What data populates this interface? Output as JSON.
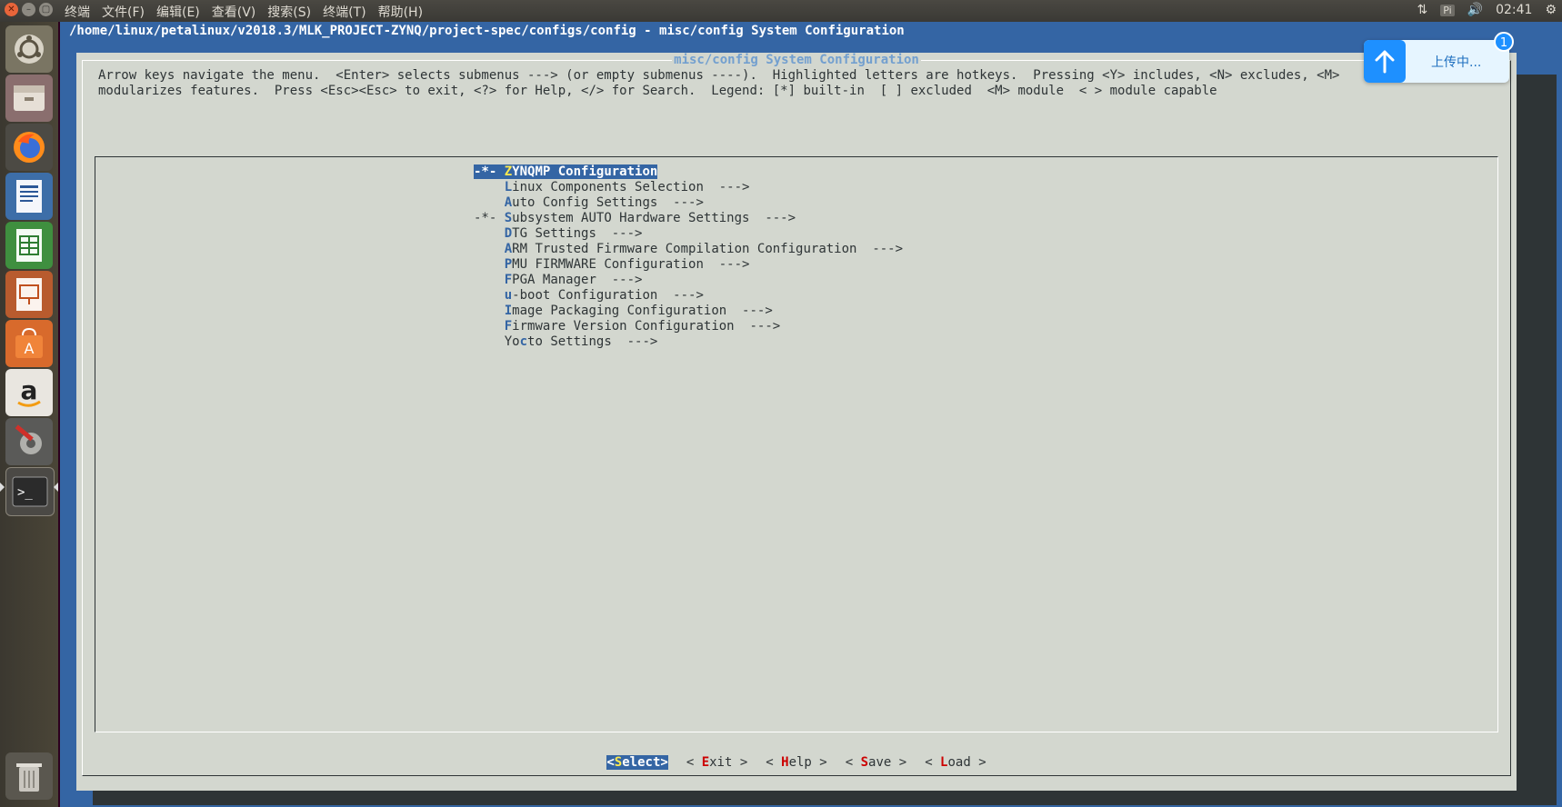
{
  "topbar": {
    "menus": [
      "终端",
      "文件(F)",
      "编辑(E)",
      "查看(V)",
      "搜索(S)",
      "终端(T)",
      "帮助(H)"
    ],
    "tray": {
      "keyboard": "Pi",
      "time": "02:41"
    }
  },
  "launcher": {
    "items": [
      "dash-icon",
      "files-icon",
      "firefox-icon",
      "writer-icon",
      "calc-icon",
      "impress-icon",
      "software-center-icon",
      "amazon-icon",
      "system-settings-icon",
      "terminal-icon",
      "trash-icon"
    ]
  },
  "terminal": {
    "path": "/home/linux/petalinux/v2018.3/MLK_PROJECT-ZYNQ/project-spec/configs/config - misc/config System Configuration",
    "dialog": {
      "title": "misc/config System Configuration",
      "help_line1": "Arrow keys navigate the menu.  <Enter> selects submenus ---> (or empty submenus ----).  Highlighted letters are hotkeys.  Pressing <Y> includes, <N> excludes, <M>",
      "help_line2": "modularizes features.  Press <Esc><Esc> to exit, <?> for Help, </> for Search.  Legend: [*] built-in  [ ] excluded  <M> module  < > module capable",
      "menu": [
        {
          "mark": "-*-",
          "hot": "Z",
          "rest": "YNQMP Configuration",
          "arrow": ""
        },
        {
          "mark": "   ",
          "hot": "L",
          "rest": "inux Components Selection",
          "arrow": "  --->"
        },
        {
          "mark": "   ",
          "hot": "A",
          "rest": "uto Config Settings",
          "arrow": "  --->"
        },
        {
          "mark": "-*-",
          "hot": "S",
          "rest": "ubsystem AUTO Hardware Settings",
          "arrow": "  --->"
        },
        {
          "mark": "   ",
          "hot": "D",
          "rest": "TG Settings",
          "arrow": "  --->"
        },
        {
          "mark": "   ",
          "hot": "A",
          "rest": "RM Trusted Firmware Compilation Configuration",
          "arrow": "  --->"
        },
        {
          "mark": "   ",
          "hot": "P",
          "rest": "MU FIRMWARE Configuration",
          "arrow": "  --->"
        },
        {
          "mark": "   ",
          "hot": "F",
          "rest": "PGA Manager",
          "arrow": "  --->"
        },
        {
          "mark": "   ",
          "hot": "u",
          "rest": "-boot Configuration",
          "arrow": "  --->"
        },
        {
          "mark": "   ",
          "hot": "I",
          "rest": "mage Packaging Configuration",
          "arrow": "  --->"
        },
        {
          "mark": "   ",
          "hot": "F",
          "rest": "irmware Version Configuration",
          "arrow": "  --->"
        },
        {
          "mark": "   ",
          "hot": "Y",
          "rest": "o",
          "hot2": "c",
          "rest2": "to Settings",
          "arrow": "  --->"
        }
      ],
      "buttons": [
        {
          "pre": "<",
          "hot": "S",
          "rest": "elect",
          "post": ">"
        },
        {
          "pre": "< ",
          "hot": "E",
          "rest": "xit",
          "post": " >"
        },
        {
          "pre": "< ",
          "hot": "H",
          "rest": "elp",
          "post": " >"
        },
        {
          "pre": "< ",
          "hot": "S",
          "rest": "ave",
          "post": " >"
        },
        {
          "pre": "< ",
          "hot": "L",
          "rest": "oad",
          "post": " >"
        }
      ]
    }
  },
  "upload": {
    "label": "上传中...",
    "badge": "1"
  },
  "colors": {
    "terminal_bg": "#3465a4",
    "dialog_bg": "#d3d7cf",
    "hotkey": "#3465a4",
    "button_hotkey": "#cc0000"
  }
}
